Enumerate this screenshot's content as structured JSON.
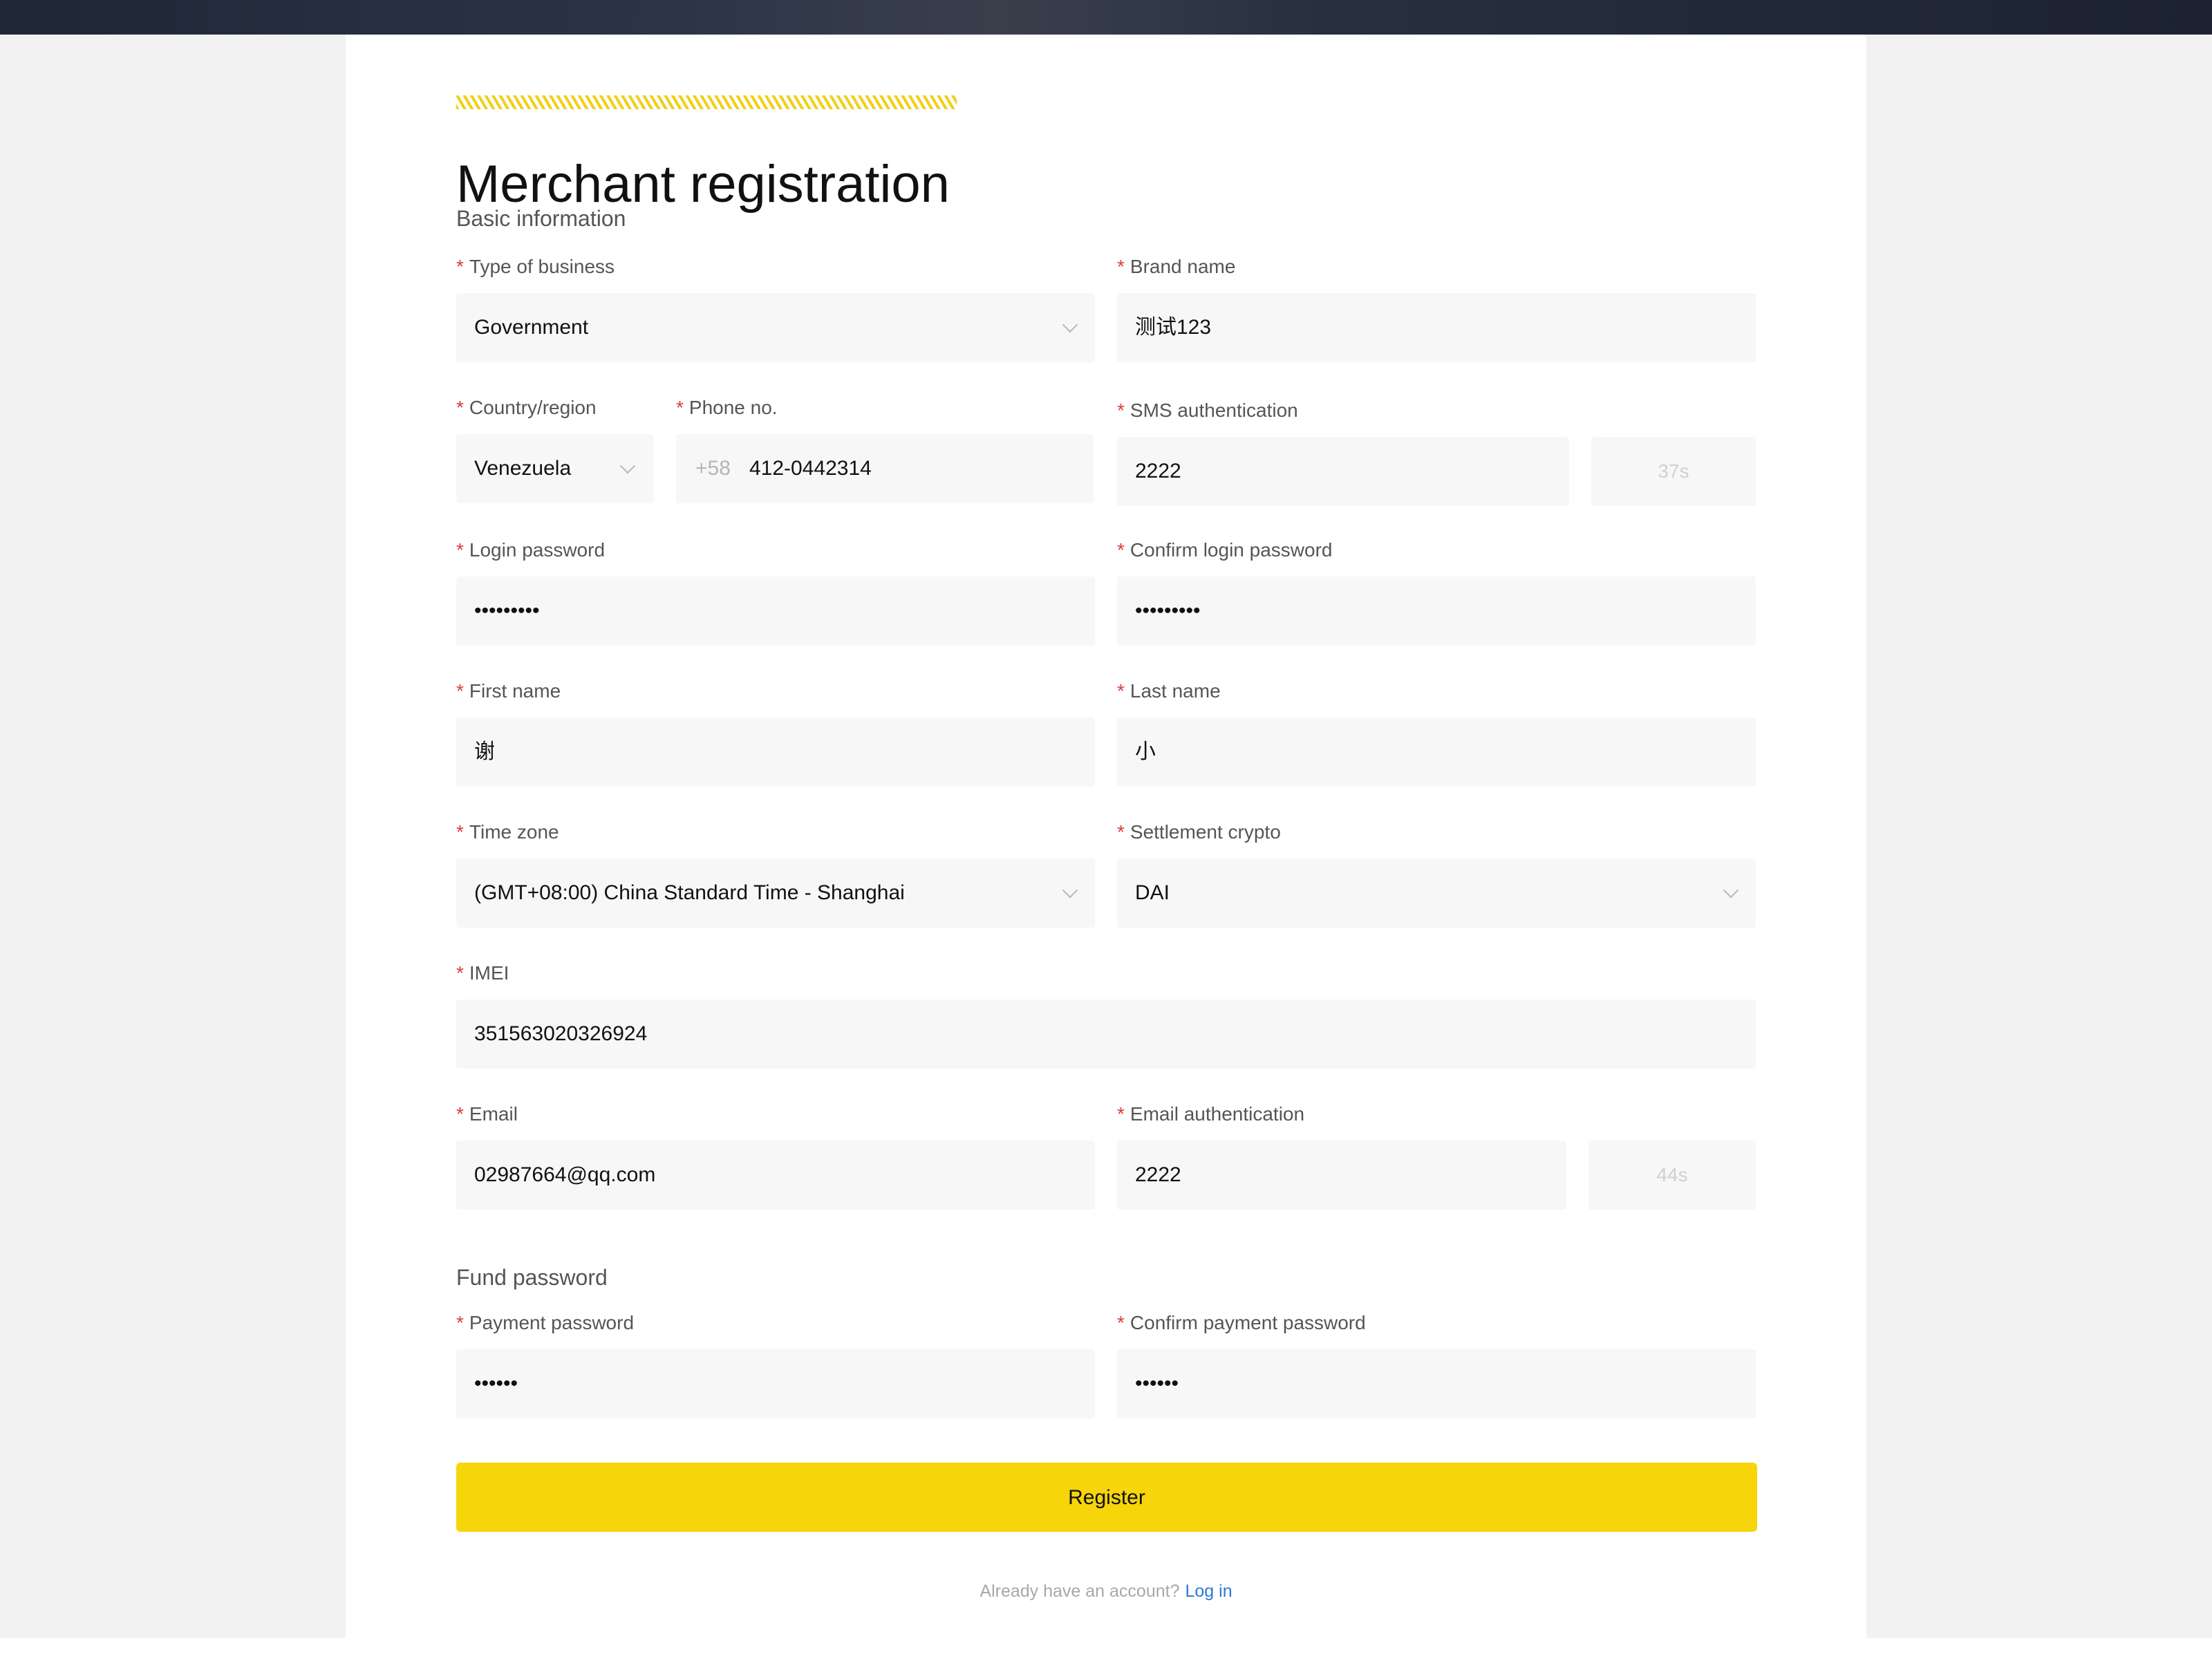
{
  "page": {
    "title": "Merchant registration",
    "accent_color": "#f6d50a",
    "required_mark": "*"
  },
  "sections": {
    "basic": "Basic information",
    "fund": "Fund password"
  },
  "fields": {
    "business_type": {
      "label": "Type of business",
      "value": "Government"
    },
    "brand_name": {
      "label": "Brand name",
      "value": "测试123"
    },
    "country": {
      "label": "Country/region",
      "value": "Venezuela"
    },
    "phone": {
      "label": "Phone no.",
      "prefix": "+58",
      "value": "412-0442314"
    },
    "sms_auth": {
      "label": "SMS authentication",
      "value": "2222",
      "countdown": "37s"
    },
    "login_password": {
      "label": "Login password",
      "value": "•••••••••"
    },
    "confirm_login_password": {
      "label": "Confirm login password",
      "value": "•••••••••"
    },
    "first_name": {
      "label": "First name",
      "value": "谢"
    },
    "last_name": {
      "label": "Last name",
      "value": "小"
    },
    "time_zone": {
      "label": "Time zone",
      "value": "(GMT+08:00) China Standard Time - Shanghai"
    },
    "settlement_crypto": {
      "label": "Settlement crypto",
      "value": "DAI"
    },
    "imei": {
      "label": "IMEI",
      "value": "351563020326924"
    },
    "email": {
      "label": "Email",
      "value": "02987664@qq.com"
    },
    "email_auth": {
      "label": "Email authentication",
      "value": "2222",
      "countdown": "44s"
    },
    "payment_password": {
      "label": "Payment password",
      "value": "••••••"
    },
    "confirm_payment_password": {
      "label": "Confirm payment password",
      "value": "••••••"
    }
  },
  "actions": {
    "register": "Register",
    "login_prompt": "Already have an account?",
    "login_link": "Log in"
  }
}
